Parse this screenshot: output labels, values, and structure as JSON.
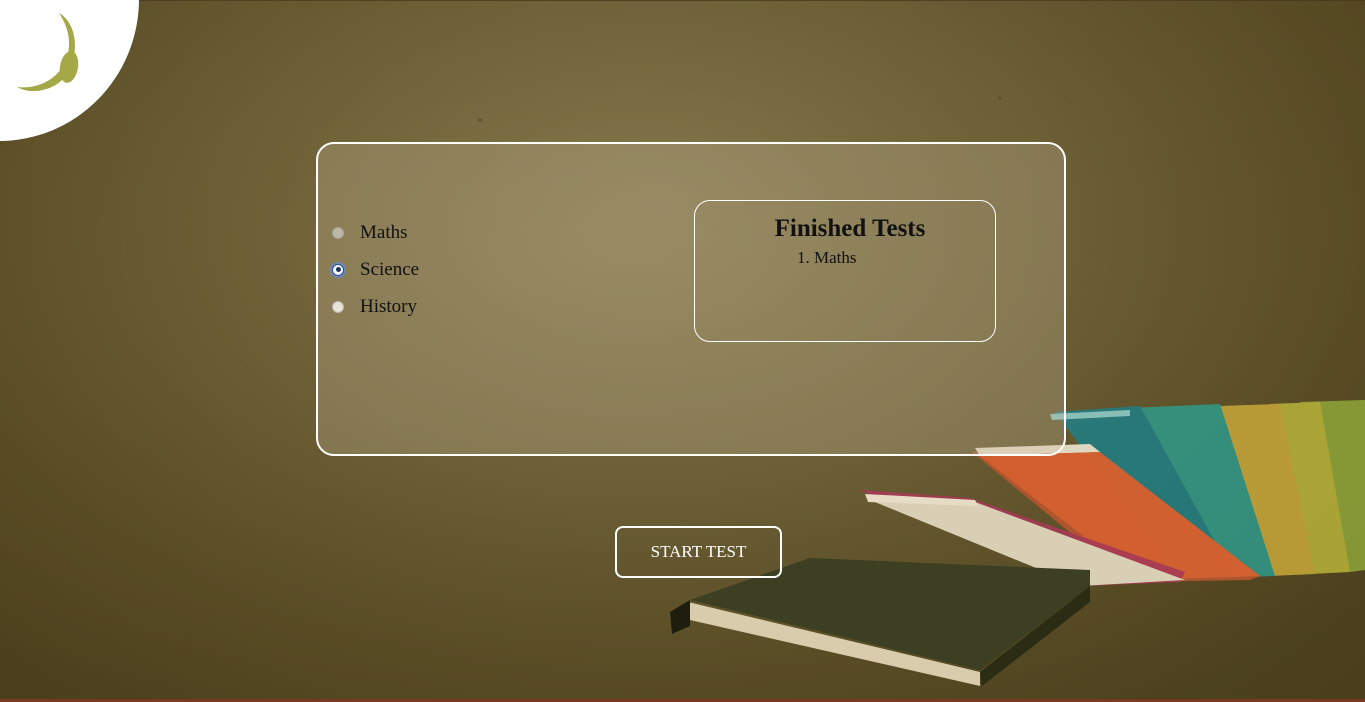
{
  "subjects": {
    "options": [
      {
        "label": "Maths",
        "state": "disabled"
      },
      {
        "label": "Science",
        "state": "checked"
      },
      {
        "label": "History",
        "state": "unchecked"
      }
    ]
  },
  "finished_tests": {
    "title": "Finished Tests",
    "items": [
      "1. Maths"
    ]
  },
  "actions": {
    "start_label": "START TEST"
  },
  "colors": {
    "background": "#7a6b3d",
    "panel_border": "#ffffff",
    "logo_green": "#a4a846",
    "button_text": "#ffffff",
    "bottom_edge": "#7a3a22"
  },
  "icons": {
    "logo": "leaf-sprout-logo-icon"
  }
}
